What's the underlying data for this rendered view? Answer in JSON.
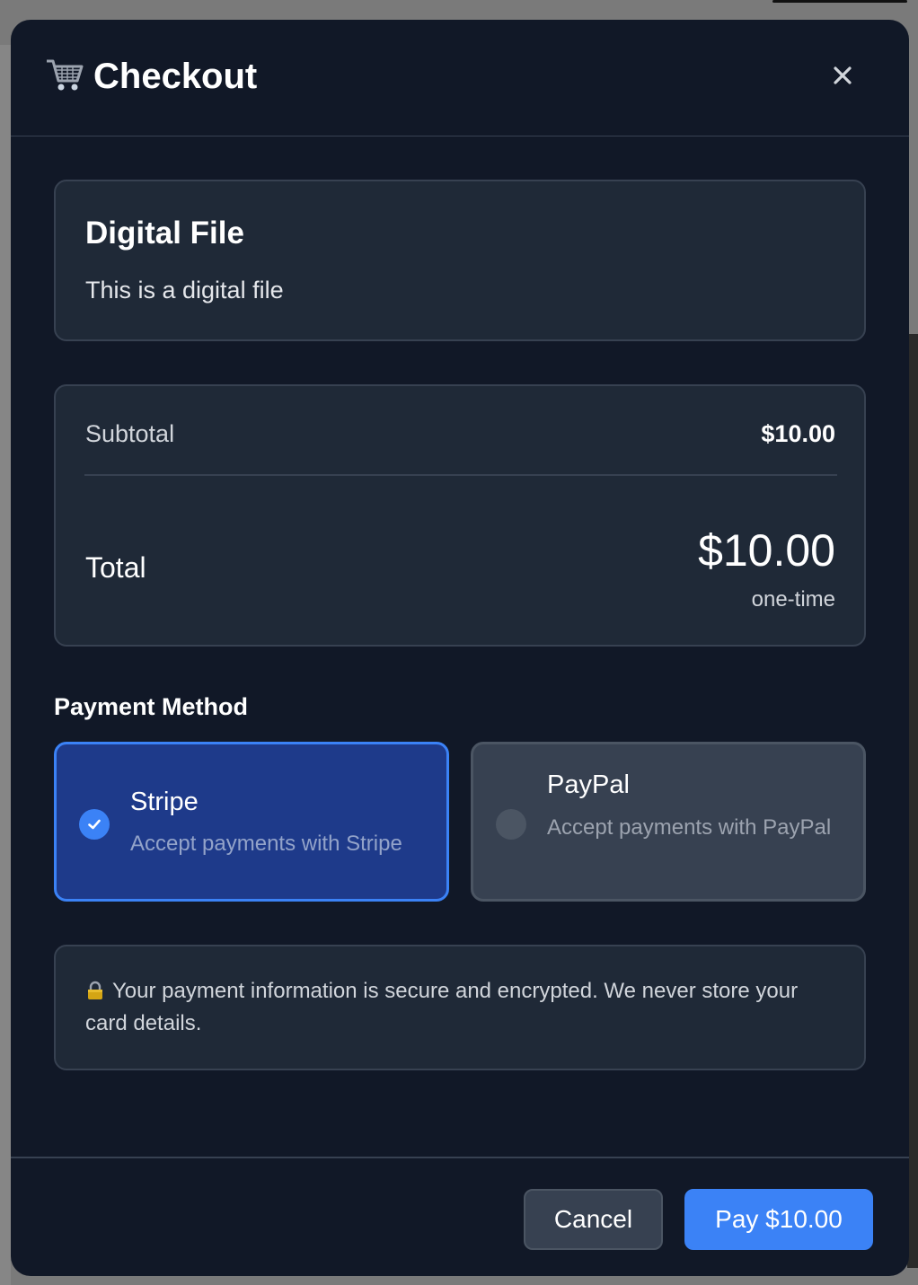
{
  "modal": {
    "title": "Checkout",
    "title_icon": "shopping-cart-icon",
    "close_icon": "close-icon"
  },
  "product": {
    "name": "Digital File",
    "description": "This is a digital file"
  },
  "summary": {
    "subtotal_label": "Subtotal",
    "subtotal_value": "$10.00",
    "total_label": "Total",
    "total_value": "$10.00",
    "total_period": "one-time"
  },
  "payment": {
    "heading": "Payment Method",
    "methods": [
      {
        "name": "Stripe",
        "description": "Accept payments with Stripe",
        "selected": true
      },
      {
        "name": "PayPal",
        "description": "Accept payments with PayPal",
        "selected": false
      }
    ]
  },
  "security": {
    "icon": "lock-icon",
    "text": "Your payment information is secure and encrypted. We never store your card details."
  },
  "footer": {
    "cancel_label": "Cancel",
    "pay_label": "Pay $10.00"
  },
  "colors": {
    "background": "#111827",
    "card": "#1f2937",
    "accent": "#3b82f6",
    "selected_method": "#1e3a8a"
  }
}
